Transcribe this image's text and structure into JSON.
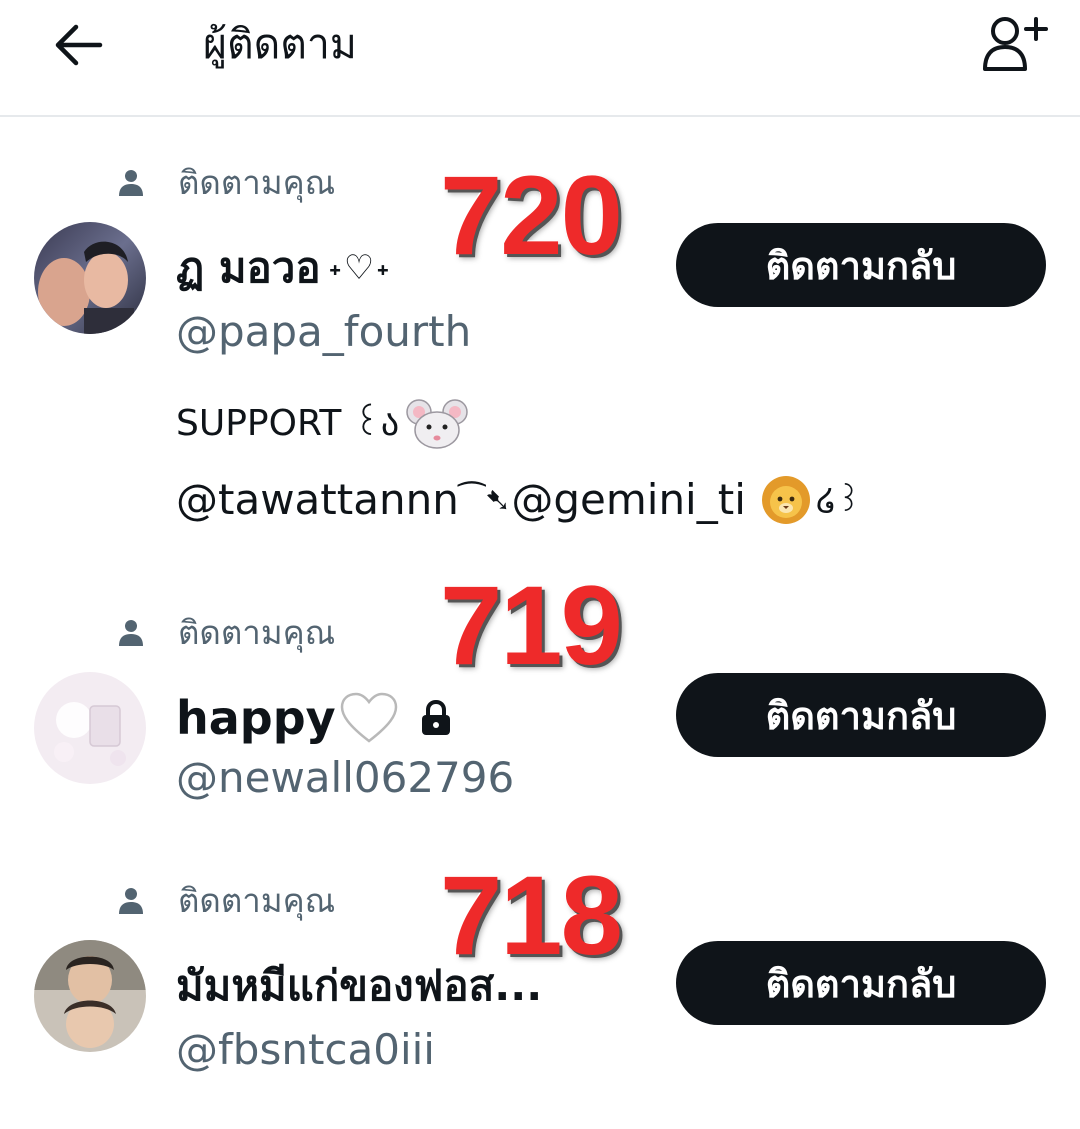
{
  "header": {
    "title": "ผู้ติดตาม"
  },
  "colors": {
    "text_primary": "#0f1419",
    "text_secondary": "#536471",
    "button_bg": "#0f1419",
    "overlay_red": "#ee2a2a",
    "divider": "#e6e9ec"
  },
  "followers": [
    {
      "follows_you_label": "ติดตามคุณ",
      "display_name": "ฏ มอวอ",
      "name_decoration": "˖♡˖",
      "handle": "@papa_fourth",
      "bio_line1": "SUPPORT ꒰ა",
      "bio_line2_a": "@tawattannn",
      "bio_line2_b": "⁀➷",
      "bio_line2_c": "@gemini_ti",
      "bio_line2_d": "໒꒱",
      "button_label": "ติดตามกลับ",
      "overlay_number": "720",
      "icons": [
        "person-icon",
        "avatar-photo",
        "mouse-emoji",
        "lion-emoji"
      ]
    },
    {
      "follows_you_label": "ติดตามคุณ",
      "display_name": "happy",
      "handle": "@newall062796",
      "button_label": "ติดตามกลับ",
      "overlay_number": "719",
      "icons": [
        "person-icon",
        "avatar-photo",
        "white-heart-emoji",
        "lock-icon"
      ]
    },
    {
      "follows_you_label": "ติดตามคุณ",
      "display_name": "มัมหมีแก่ของฟอส...",
      "handle": "@fbsntca0iii",
      "button_label": "ติดตามกลับ",
      "overlay_number": "718",
      "icons": [
        "person-icon",
        "avatar-photo"
      ]
    }
  ]
}
